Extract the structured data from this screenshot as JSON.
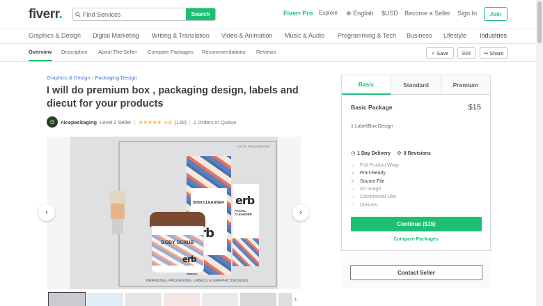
{
  "header": {
    "logo_text": "fiverr",
    "logo_dot": ".",
    "search_placeholder": "Find Services",
    "search_button": "Search",
    "fiverr_pro": "Fiverr Pro",
    "explore": "Explore",
    "language": "English",
    "currency": "$USD",
    "become_seller": "Become a Seller",
    "sign_in": "Sign In",
    "join": "Join"
  },
  "categories": [
    "Graphics & Design",
    "Digital Marketing",
    "Writing & Translation",
    "Video & Animation",
    "Music & Audio",
    "Programming & Tech",
    "Business",
    "Lifestyle",
    "Industries"
  ],
  "subnav": {
    "items": [
      "Overview",
      "Description",
      "About The Seller",
      "Compare Packages",
      "Recommendations",
      "Reviews"
    ],
    "save": "Save",
    "save_count": "934",
    "share": "Share"
  },
  "breadcrumb": {
    "parent": "Graphics & Design",
    "separator": "›",
    "child": "Packaging Design"
  },
  "gig": {
    "title": "I will do premium box , packaging design, labels and diecut for your products",
    "seller_name": "nicepackaging",
    "seller_level": "Level 2 Seller",
    "stars": "★★★★★",
    "rating": "4.9",
    "review_count": "(138)",
    "queue": "2 Orders in Queue",
    "pipe": "|"
  },
  "gallery": {
    "watermark": "NICE PACKAGING",
    "banner": "BRANDING, PACKAGING, LABELS & GRAPHIC DESIGNS.",
    "skin_cleanser": "SKIN CLEANSER",
    "facial_cleanser": "FACIAL CLEANSER",
    "body_scrub": "BODY SCRUB",
    "brand": "erb",
    "prev": "‹",
    "next": "›"
  },
  "package": {
    "tabs": [
      "Basic",
      "Standard",
      "Premium"
    ],
    "name": "Basic Package",
    "price": "$15",
    "description": "1 Label/Box Design",
    "delivery": "1 Day Delivery",
    "revisions": "8 Revisions",
    "features": [
      {
        "label": "Full Product Wrap",
        "included": false
      },
      {
        "label": "Print-Ready",
        "included": true
      },
      {
        "label": "Source File",
        "included": true
      },
      {
        "label": "3D Image",
        "included": false
      },
      {
        "label": "Commercial Use",
        "included": false
      },
      {
        "label": "Dielines",
        "included": false
      }
    ],
    "continue": "Continue ($15)",
    "compare": "Compare Packages"
  },
  "contact": "Contact Seller",
  "colors": {
    "brand_green": "#1dbf73",
    "link_blue": "#446ee7",
    "star_yellow": "#ffb33e",
    "text_dark": "#404145"
  }
}
